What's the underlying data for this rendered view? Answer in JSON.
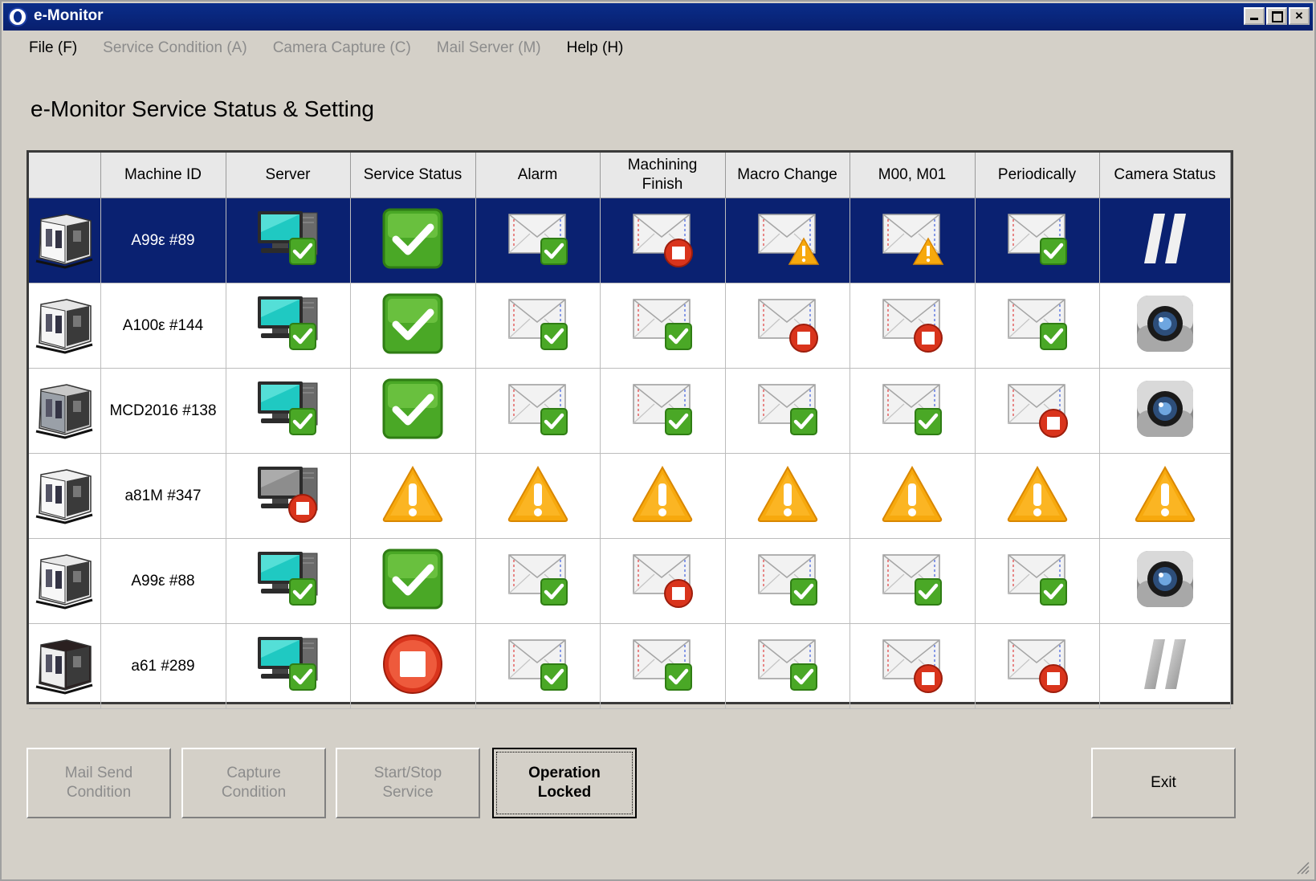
{
  "window": {
    "title": "e-Monitor"
  },
  "menu": [
    {
      "label": "File (F)",
      "enabled": true
    },
    {
      "label": "Service Condition (A)",
      "enabled": false
    },
    {
      "label": "Camera Capture (C)",
      "enabled": false
    },
    {
      "label": "Mail Server (M)",
      "enabled": false
    },
    {
      "label": "Help (H)",
      "enabled": true
    }
  ],
  "heading": "e-Monitor Service Status & Setting",
  "table": {
    "columns": [
      "",
      "Machine ID",
      "Server",
      "Service Status",
      "Alarm",
      "Machining Finish",
      "Macro Change",
      "M00, M01",
      "Periodically",
      "Camera Status"
    ],
    "selected_row": 0,
    "rows": [
      {
        "machine_id": "A99ε #89",
        "server": "server-online-icon",
        "service": "ok-icon",
        "alarm": "mail-ok-icon",
        "finish": "mail-stop-icon",
        "macro": "mail-warn-icon",
        "m00": "mail-warn-icon",
        "periodic": "mail-ok-icon",
        "camera": "pause-icon"
      },
      {
        "machine_id": "A100ε #144",
        "server": "server-online-icon",
        "service": "ok-icon",
        "alarm": "mail-ok-icon",
        "finish": "mail-ok-icon",
        "macro": "mail-stop-icon",
        "m00": "mail-stop-icon",
        "periodic": "mail-ok-icon",
        "camera": "camera-icon"
      },
      {
        "machine_id": "MCD2016 #138",
        "server": "server-online-icon",
        "service": "ok-icon",
        "alarm": "mail-ok-icon",
        "finish": "mail-ok-icon",
        "macro": "mail-ok-icon",
        "m00": "mail-ok-icon",
        "periodic": "mail-stop-icon",
        "camera": "camera-icon"
      },
      {
        "machine_id": "a81M #347",
        "server": "server-offline-icon",
        "service": "warning-icon",
        "alarm": "warning-icon",
        "finish": "warning-icon",
        "macro": "warning-icon",
        "m00": "warning-icon",
        "periodic": "warning-icon",
        "camera": "warning-icon"
      },
      {
        "machine_id": "A99ε #88",
        "server": "server-online-icon",
        "service": "ok-icon",
        "alarm": "mail-ok-icon",
        "finish": "mail-stop-icon",
        "macro": "mail-ok-icon",
        "m00": "mail-ok-icon",
        "periodic": "mail-ok-icon",
        "camera": "camera-icon"
      },
      {
        "machine_id": "a61 #289",
        "server": "server-online-icon",
        "service": "stop-icon",
        "alarm": "mail-ok-icon",
        "finish": "mail-ok-icon",
        "macro": "mail-ok-icon",
        "m00": "mail-stop-icon",
        "periodic": "mail-stop-icon",
        "camera": "pause-gray-icon"
      }
    ]
  },
  "buttons": [
    {
      "label_line1": "Mail Send",
      "label_line2": "Condition",
      "enabled": false
    },
    {
      "label_line1": "Capture",
      "label_line2": "Condition",
      "enabled": false
    },
    {
      "label_line1": "Start/Stop",
      "label_line2": "Service",
      "enabled": false
    },
    {
      "label_line1": "Operation",
      "label_line2": "Locked",
      "enabled": true
    },
    {
      "label_line1": "Exit",
      "label_line2": "",
      "enabled": true
    }
  ],
  "colors": {
    "title_bar": "#0a2d8a",
    "selected_row": "#0a2171",
    "ok_green": "#56b82e",
    "warn_orange": "#f5a20a",
    "stop_red": "#d9341c"
  }
}
